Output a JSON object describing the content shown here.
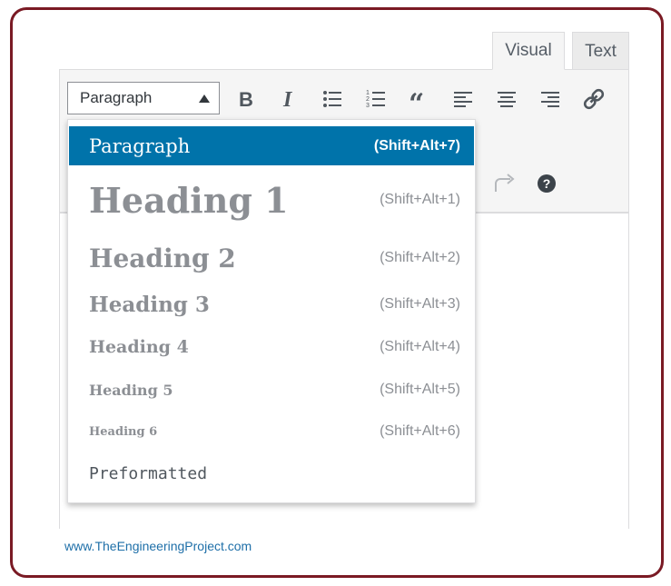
{
  "tabs": {
    "visual": "Visual",
    "text": "Text"
  },
  "toolbar": {
    "format_select_value": "Paragraph",
    "buttons": [
      "bold-icon",
      "italic-icon",
      "bullet-list-icon",
      "numbered-list-icon",
      "blockquote-icon",
      "align-left-icon",
      "align-center-icon",
      "align-right-icon",
      "link-icon",
      "redo-icon",
      "help-icon"
    ]
  },
  "dropdown": {
    "items": [
      {
        "label": "Paragraph",
        "shortcut": "(Shift+Alt+7)",
        "selected": true
      },
      {
        "label": "Heading 1",
        "shortcut": "(Shift+Alt+1)"
      },
      {
        "label": "Heading 2",
        "shortcut": "(Shift+Alt+2)"
      },
      {
        "label": "Heading 3",
        "shortcut": "(Shift+Alt+3)"
      },
      {
        "label": "Heading 4",
        "shortcut": "(Shift+Alt+4)"
      },
      {
        "label": "Heading 5",
        "shortcut": "(Shift+Alt+5)"
      },
      {
        "label": "Heading 6",
        "shortcut": "(Shift+Alt+6)"
      },
      {
        "label": "Preformatted",
        "shortcut": ""
      }
    ]
  },
  "watermark": "www.TheEngineeringProject.com",
  "colors": {
    "frame": "#7a1a24",
    "selected": "#0073aa",
    "muted_text": "#8c8f94"
  }
}
